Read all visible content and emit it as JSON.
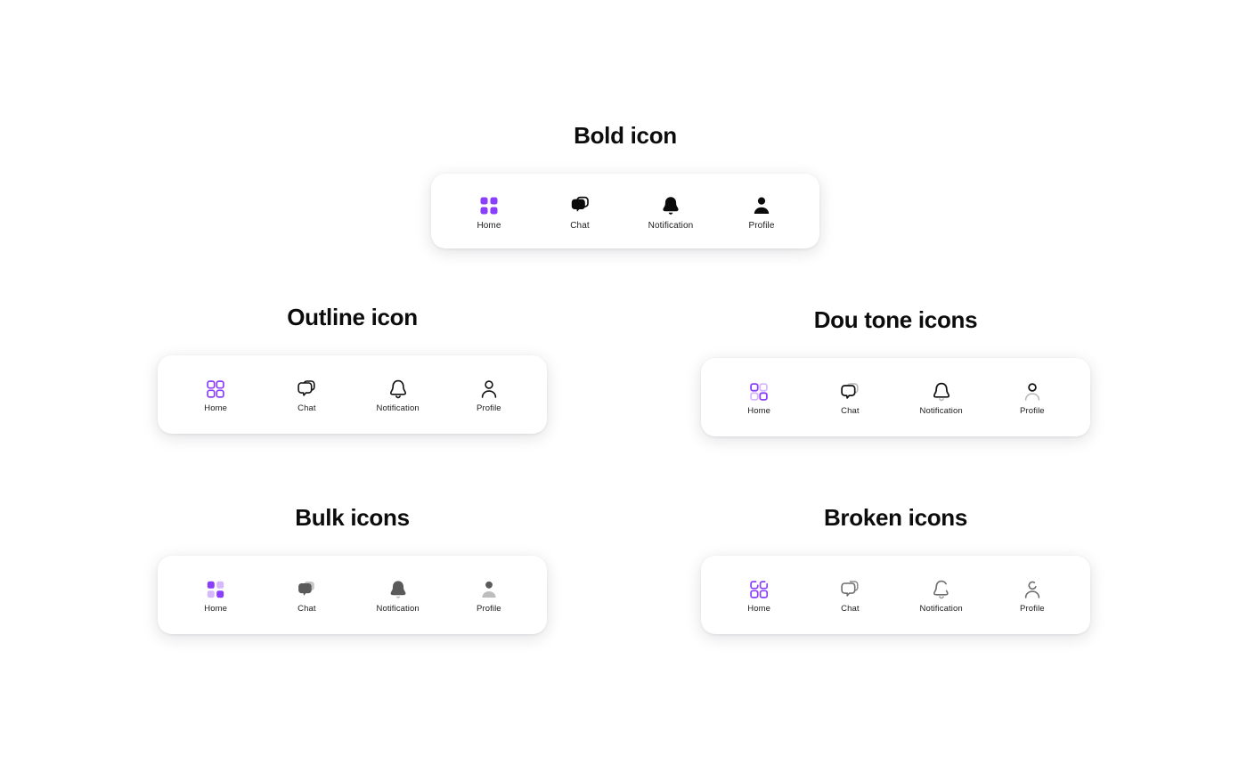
{
  "page": {
    "background": "#ffffff",
    "accent_purple": "#8a3ffc",
    "accent_purple_light": "#d5b8fd",
    "bulk_dark": "#5a5a5a",
    "bulk_light": "#bdbdbd",
    "outline_stroke": "#121212",
    "broken_stroke": "#6f6f6f",
    "label_color": "#1c1c1c"
  },
  "sections": [
    {
      "id": "bold",
      "title": "Bold icon",
      "style": "bold",
      "items": [
        {
          "label": "Home",
          "icon": "home-grid-icon",
          "active": true
        },
        {
          "label": "Chat",
          "icon": "chat-bubble-icon",
          "active": false
        },
        {
          "label": "Notification",
          "icon": "bell-icon",
          "active": false
        },
        {
          "label": "Profile",
          "icon": "person-icon",
          "active": false
        }
      ]
    },
    {
      "id": "outline",
      "title": "Outline icon",
      "style": "outline",
      "items": [
        {
          "label": "Home",
          "icon": "home-grid-icon",
          "active": true
        },
        {
          "label": "Chat",
          "icon": "chat-bubble-icon",
          "active": false
        },
        {
          "label": "Notification",
          "icon": "bell-icon",
          "active": false
        },
        {
          "label": "Profile",
          "icon": "person-icon",
          "active": false
        }
      ]
    },
    {
      "id": "doutone",
      "title": "Dou tone icons",
      "style": "duotone",
      "items": [
        {
          "label": "Home",
          "icon": "home-grid-icon",
          "active": true
        },
        {
          "label": "Chat",
          "icon": "chat-bubble-icon",
          "active": false
        },
        {
          "label": "Notification",
          "icon": "bell-icon",
          "active": false
        },
        {
          "label": "Profile",
          "icon": "person-icon",
          "active": false
        }
      ]
    },
    {
      "id": "bulk",
      "title": "Bulk icons",
      "style": "bulk",
      "items": [
        {
          "label": "Home",
          "icon": "home-grid-icon",
          "active": true
        },
        {
          "label": "Chat",
          "icon": "chat-bubble-icon",
          "active": false
        },
        {
          "label": "Notification",
          "icon": "bell-icon",
          "active": false
        },
        {
          "label": "Profile",
          "icon": "person-icon",
          "active": false
        }
      ]
    },
    {
      "id": "broken",
      "title": "Broken icons",
      "style": "broken",
      "items": [
        {
          "label": "Home",
          "icon": "home-grid-icon",
          "active": true
        },
        {
          "label": "Chat",
          "icon": "chat-bubble-icon",
          "active": false
        },
        {
          "label": "Notification",
          "icon": "bell-icon",
          "active": false
        },
        {
          "label": "Profile",
          "icon": "person-icon",
          "active": false
        }
      ]
    }
  ]
}
